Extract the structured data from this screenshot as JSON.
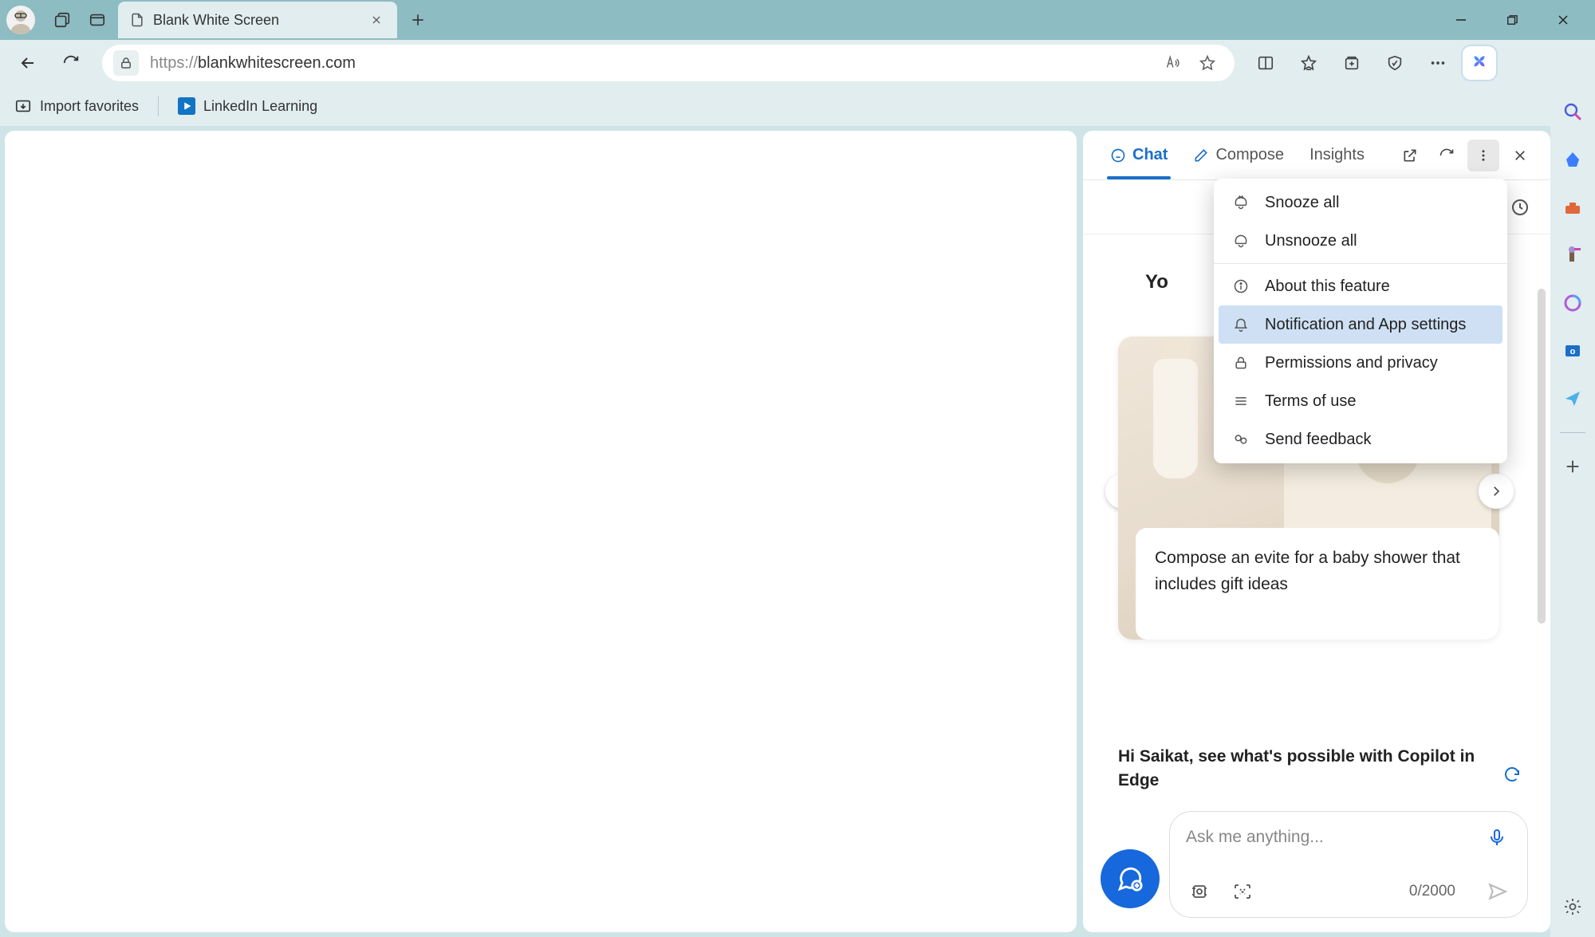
{
  "tab": {
    "title": "Blank White Screen"
  },
  "address": {
    "scheme": "https://",
    "host": "blankwhitescreen.com"
  },
  "bookmarks": {
    "import": "Import favorites",
    "linkedin": "LinkedIn Learning"
  },
  "copilot": {
    "tabs": {
      "chat": "Chat",
      "compose": "Compose",
      "insights": "Insights"
    },
    "peek_heading_left": "Yo",
    "suggestion_caption": "Compose an evite for a baby shower that includes gift ideas",
    "followup": "Hi Saikat, see what's possible with Copilot in Edge",
    "prompt_placeholder": "Ask me anything...",
    "char_count": "0/2000"
  },
  "menu": {
    "snooze_all": "Snooze all",
    "unsnooze_all": "Unsnooze all",
    "about": "About this feature",
    "notif_settings": "Notification and App settings",
    "permissions": "Permissions and privacy",
    "terms": "Terms of use",
    "feedback": "Send feedback"
  }
}
